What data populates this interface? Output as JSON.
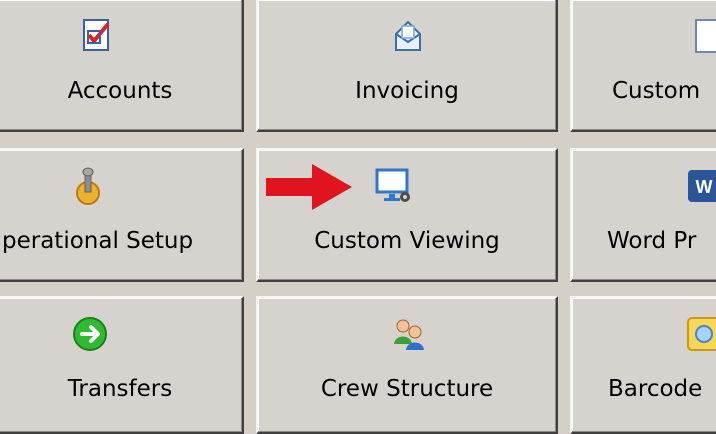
{
  "tiles": {
    "accounts": "Accounts",
    "invoicing": "Invoicing",
    "customers_partial": "Custom",
    "operational_setup_partial": "perational Setup",
    "custom_viewing": "Custom Viewing",
    "word_partial": "Word Pr",
    "transfers": "Transfers",
    "crew_structure": "Crew Structure",
    "barcode_partial": "Barcode"
  },
  "icons": {
    "accounts": "checklist-icon",
    "invoicing": "invoice-envelope-icon",
    "customers": "document-icon",
    "operational_setup": "joystick-gear-icon",
    "custom_viewing": "monitor-gear-icon",
    "word": "word-icon",
    "transfers": "green-arrow-circle-icon",
    "crew_structure": "users-icon",
    "barcode": "barcode-icon"
  },
  "annotation": {
    "arrow_color": "#e0141e"
  }
}
